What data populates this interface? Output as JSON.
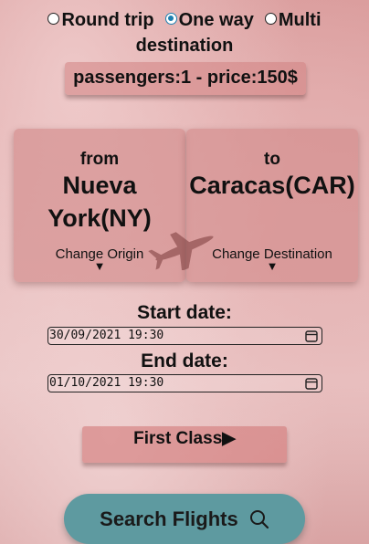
{
  "trip_type": {
    "options": [
      {
        "label": "Round trip",
        "checked": false
      },
      {
        "label": "One way",
        "checked": true
      },
      {
        "label": "Multi",
        "checked": false
      }
    ],
    "multi_continuation": "destination"
  },
  "summary": {
    "text": "passengers:1 - price:150$"
  },
  "origin": {
    "prefix": "from",
    "city_line1": "Nueva",
    "city_line2": "York(NY)",
    "change_label": "Change Origin",
    "arrow": "▼"
  },
  "destination": {
    "prefix": "to",
    "city": "Caracas(CAR)",
    "change_label": "Change Destination",
    "arrow": "▼"
  },
  "start_date": {
    "label": "Start date:",
    "value": "30/09/2021 19:30"
  },
  "end_date": {
    "label": "End date:",
    "value": "01/10/2021 19:30"
  },
  "class_button": {
    "label": "First Class▶"
  },
  "search_button": {
    "label": "Search Flights",
    "icon": "search-icon"
  },
  "colors": {
    "accent": "#1c7fb0",
    "search_button_bg": "#5e9aa0"
  }
}
